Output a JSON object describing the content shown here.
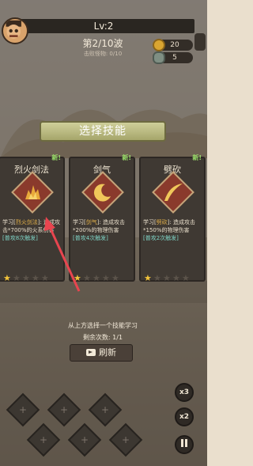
{
  "hud": {
    "level": "Lv:2",
    "wave": "第2/10波",
    "kills": "击败怪物: 0/10",
    "coins": "20",
    "gems": "5"
  },
  "dialog": {
    "title": "选择技能",
    "info": "从上方选择一个技能学习",
    "remaining": "剩余次数: 1/1",
    "refresh_label": "刷新"
  },
  "cards": [
    {
      "new_badge": "新!",
      "name": "烈火剑法",
      "desc_prefix": "学习[",
      "desc_skill": "烈火剑法",
      "desc_suffix": "]: 造成攻击*700%的火系伤害",
      "trigger": "[普攻8次触发]",
      "stars_filled": 1,
      "stars_total": 5,
      "icon": "flame-icon",
      "icon_color": "#e8a93a"
    },
    {
      "new_badge": "新!",
      "name": "剑气",
      "desc_prefix": "学习[",
      "desc_skill": "剑气",
      "desc_suffix": "]: 造成攻击*200%的物理伤害",
      "trigger": "[普攻4次触发]",
      "stars_filled": 1,
      "stars_total": 5,
      "icon": "crescent-icon",
      "icon_color": "#f0c75a"
    },
    {
      "new_badge": "新!",
      "name": "劈砍",
      "desc_prefix": "学习[",
      "desc_skill": "劈砍",
      "desc_suffix": "]: 造成攻击*150%的物理伤害",
      "trigger": "[普攻2次触发]",
      "stars_filled": 1,
      "stars_total": 5,
      "icon": "slash-icon",
      "icon_color": "#f0c75a"
    }
  ],
  "controls": {
    "speed3": "x3",
    "speed2": "x2"
  },
  "colors": {
    "accent_gold": "#f3c43a",
    "trigger_teal": "#7fd6c8",
    "new_green": "#9ae06a",
    "arrow_red": "#e8454f"
  }
}
